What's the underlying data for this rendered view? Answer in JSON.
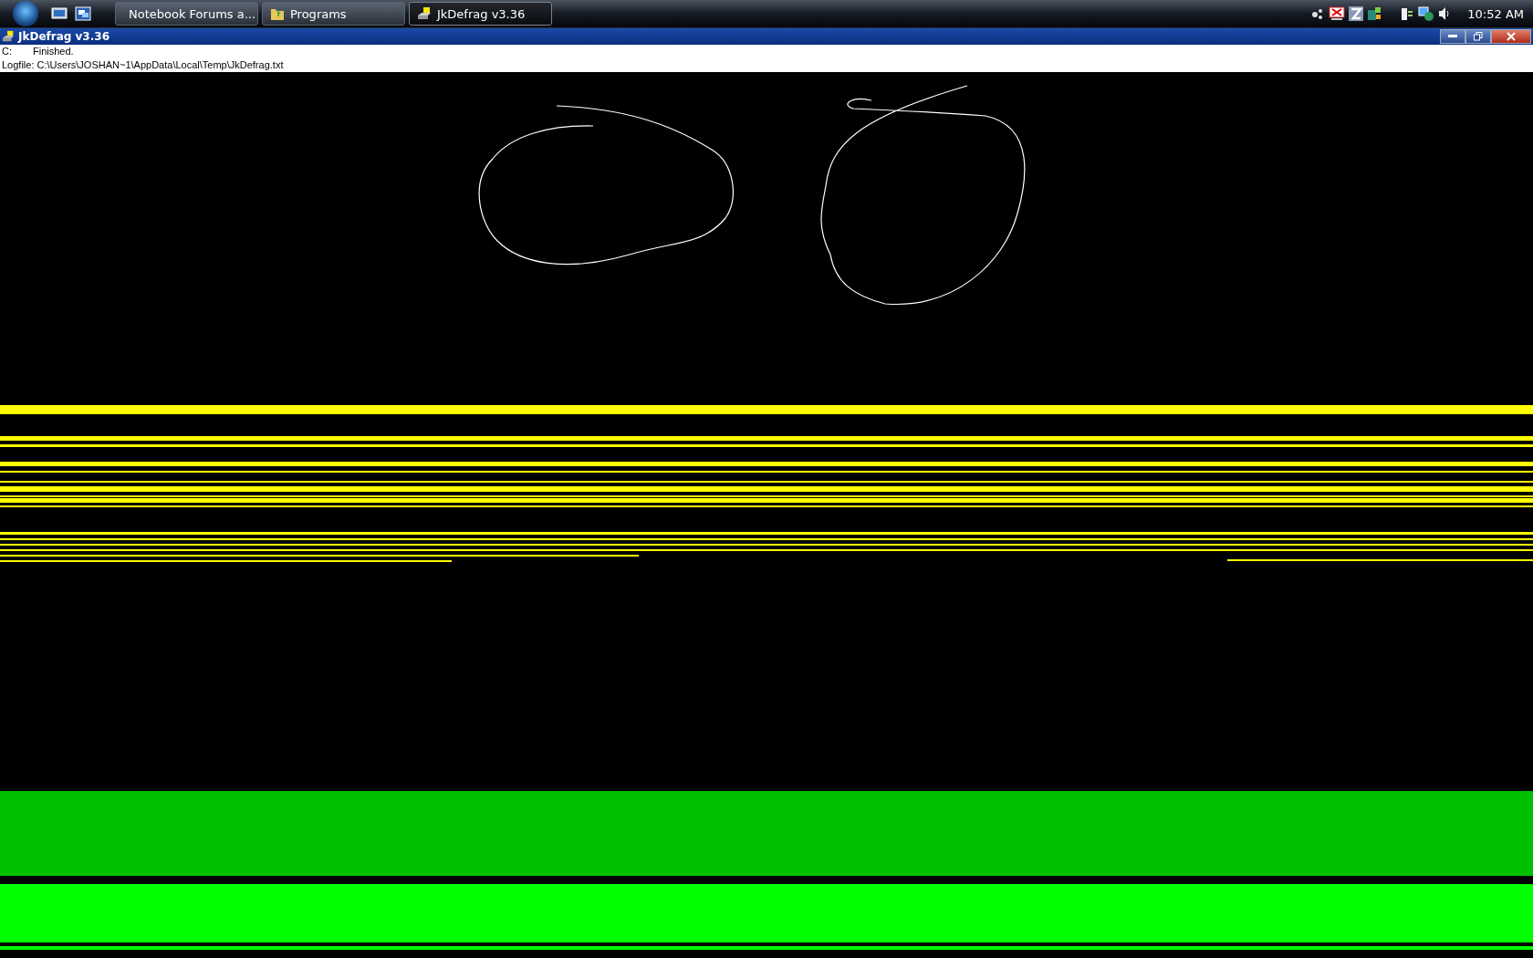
{
  "taskbar": {
    "tasks": [
      {
        "label": "Notebook Forums a...",
        "kind": "browser",
        "selected": false
      },
      {
        "label": "Programs",
        "kind": "folder",
        "selected": false
      },
      {
        "label": "JkDefrag v3.36",
        "kind": "defrag",
        "selected": true
      }
    ],
    "clock": "10:52 AM"
  },
  "window": {
    "title": "JkDefrag v3.36",
    "status_lines": [
      {
        "drive": "C:",
        "message": "Finished."
      }
    ],
    "logfile": "Logfile: C:\\Users\\JOSHAN~1\\AppData\\Local\\Temp\\JkDefrag.txt"
  }
}
